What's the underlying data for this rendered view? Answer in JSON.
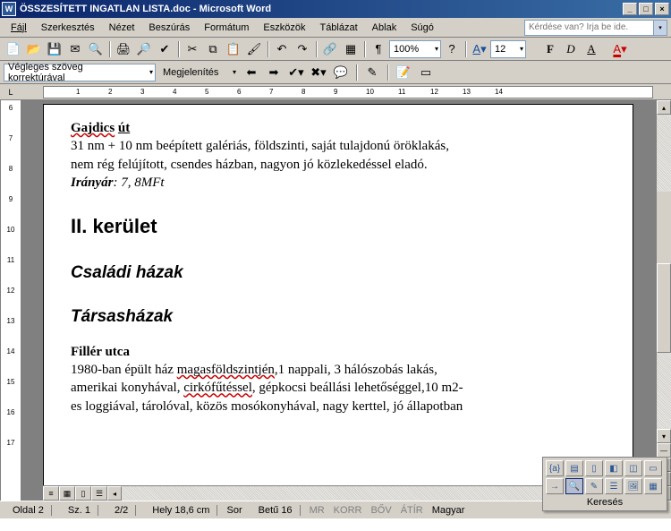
{
  "window": {
    "title": "ÖSSZESÍTETT INGATLAN LISTA.doc - Microsoft Word",
    "app_icon": "W"
  },
  "menu": {
    "file": "Fájl",
    "edit": "Szerkesztés",
    "view": "Nézet",
    "insert": "Beszúrás",
    "format": "Formátum",
    "tools": "Eszközök",
    "table": "Táblázat",
    "window": "Ablak",
    "help": "Súgó"
  },
  "ask": {
    "placeholder": "Kérdése van? Írja be ide."
  },
  "toolbar1": {
    "zoom": "100%",
    "fontsize": "12",
    "bold": "F",
    "italic": "D",
    "underline": "A"
  },
  "toolbar2": {
    "reviewing": "Végleges szöveg korrektúrával",
    "display": "Megjelenítés"
  },
  "ruler": {
    "v": [
      "6",
      "",
      "7",
      "",
      "8",
      "",
      "9",
      "",
      "10",
      "",
      "11",
      "",
      "12",
      "",
      "13",
      "",
      "14",
      "",
      "15",
      "",
      "16",
      "",
      "17"
    ],
    "h": [
      "",
      "1",
      "",
      "2",
      "",
      "3",
      "",
      "4",
      "",
      "5",
      "",
      "6",
      "",
      "7",
      "",
      "8",
      "",
      "9",
      "",
      "10",
      "",
      "11",
      "",
      "12",
      "",
      "13",
      "",
      "14"
    ]
  },
  "document": {
    "p1_title": "Gajdics út",
    "p1_l1": "31 nm + 10 nm beépített galériás, földszinti, saját tulajdonú öröklakás,",
    "p1_l2": "nem rég felújított, csendes házban, nagyon jó közlekedéssel eladó.",
    "p1_price_label": "Irányár",
    "p1_price_value": ": 7, 8MFt",
    "h_district": "II. kerület",
    "h_family": "Családi házak",
    "h_condo": "Társasházak",
    "p2_title": "Fillér utca",
    "p2_l1a": "1980-ban épült ház ",
    "p2_l1b": "magasföldszintjén",
    "p2_l1c": ",1 nappali, 3 hálószobás lakás,",
    "p2_l2a": "amerikai konyhával, ",
    "p2_l2b": "cirkófűtéssel",
    "p2_l2c": ", gépkocsi beállási lehetőséggel,10 m2-",
    "p2_l3": "es loggiával, tárolóval, közös mosókonyhával, nagy kerttel, jó állapotban"
  },
  "status": {
    "page_label": "Oldal",
    "page": "2",
    "sec_label": "Sz.",
    "sec": "1",
    "pages": "2/2",
    "pos_label": "Hely",
    "pos": "18,6 cm",
    "line_label": "Sor",
    "col_label": "Betű",
    "col": "16",
    "mr": "MR",
    "korr": "KORR",
    "bov": "BŐV",
    "atir": "ÁTÍR",
    "lang": "Magyar"
  },
  "find": {
    "label": "Keresés"
  }
}
